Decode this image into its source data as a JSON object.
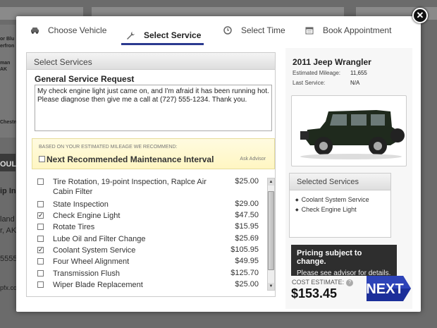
{
  "steps": [
    {
      "label": "Choose Vehicle",
      "icon": "car-icon"
    },
    {
      "label": "Select Service",
      "icon": "wrench-icon"
    },
    {
      "label": "Select Time",
      "icon": "clock-icon"
    },
    {
      "label": "Book Appointment",
      "icon": "calendar-icon"
    }
  ],
  "active_step": "Select Service",
  "background_page": {
    "fragments": [
      "or Blu",
      "erfron",
      "man",
      "AK",
      "Chestn",
      "OULE",
      "ip In",
      "land S",
      "r, AK",
      "5555",
      "pfx.co"
    ]
  },
  "select_services": {
    "header": "Select Services",
    "general_title": "General Service Request",
    "general_text": "My check engine light just came on, and I'm afraid it has been running hot. Please diagnose then give me a call at (727) 555-1234. Thank you.",
    "recommend_small": "BASED ON YOUR ESTIMATED MILEAGE WE RECOMMEND:",
    "recommend_label": "Next Recommended Maintenance Interval",
    "ask_advisor": "Ask Advisor",
    "services": [
      {
        "name": "Tire Rotation, 19-point Inspection, Raplce Air Cabin Filter",
        "price": "$25.00",
        "checked": false
      },
      {
        "name": "State Inspection",
        "price": "$29.00",
        "checked": false
      },
      {
        "name": "Check Engine Light",
        "price": "$47.50",
        "checked": true
      },
      {
        "name": "Rotate Tires",
        "price": "$15.95",
        "checked": false
      },
      {
        "name": "Lube Oil and Filter Change",
        "price": "$25.69",
        "checked": false
      },
      {
        "name": "Coolant System Service",
        "price": "$105.95",
        "checked": true
      },
      {
        "name": "Four Wheel Alignment",
        "price": "$49.95",
        "checked": false
      },
      {
        "name": "Transmission Flush",
        "price": "$125.70",
        "checked": false
      },
      {
        "name": "Wiper Blade Replacement",
        "price": "$25.00",
        "checked": false
      }
    ]
  },
  "vehicle": {
    "title": "2011 Jeep Wrangler",
    "mileage_label": "Estimated Mileage:",
    "mileage_value": "11,655",
    "last_service_label": "Last Service:",
    "last_service_value": "N/A",
    "image_icon": "jeep-image"
  },
  "selected_services": {
    "header": "Selected Services",
    "items": [
      "Coolant System Service",
      "Check Engine Light"
    ]
  },
  "pricing": {
    "line1": "Pricing subject to change.",
    "line2": "Please see advisor for details."
  },
  "cost": {
    "label": "COST ESTIMATE:",
    "value": "$153.45"
  },
  "next_label": "NEXT",
  "colors": {
    "accent": "#2b3a8f",
    "next_button": "#1c2f9a",
    "pricing_bg": "#2e2e2e",
    "recommend_bg": "#fff6c2"
  }
}
